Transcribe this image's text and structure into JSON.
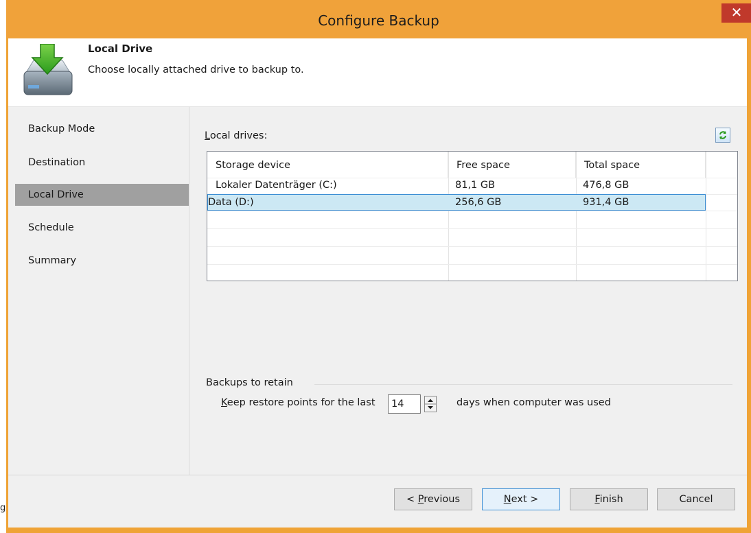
{
  "window": {
    "title": "Configure Backup",
    "close_glyph": "✕"
  },
  "header": {
    "title": "Local Drive",
    "description": "Choose locally attached drive to backup to.",
    "icon": "drive-download-icon"
  },
  "sidebar": {
    "items": [
      {
        "label": "Backup Mode",
        "active": false
      },
      {
        "label": "Destination",
        "active": false
      },
      {
        "label": "Local Drive",
        "active": true
      },
      {
        "label": "Schedule",
        "active": false
      },
      {
        "label": "Summary",
        "active": false
      }
    ]
  },
  "drives": {
    "label_prefix": "",
    "label_underlined": "L",
    "label_rest": "ocal drives:",
    "columns": [
      "Storage device",
      "Free space",
      "Total space"
    ],
    "rows": [
      {
        "device": "Lokaler Datenträger (C:)",
        "free": "81,1 GB",
        "total": "476,8 GB",
        "selected": false
      },
      {
        "device": "Data (D:)",
        "free": "256,6 GB",
        "total": "931,4 GB",
        "selected": true
      }
    ]
  },
  "retention": {
    "group_label": "Backups to retain",
    "keep_prefix": "K",
    "keep_rest": "eep restore points for the last",
    "days_value": "14",
    "days_label": "days when computer was used"
  },
  "buttons": {
    "previous_pre": "< ",
    "previous_u": "P",
    "previous_rest": "revious",
    "next_u": "N",
    "next_rest": "ext >",
    "finish_u": "F",
    "finish_rest": "inish",
    "cancel": "Cancel"
  },
  "edge_text": "gl",
  "colors": {
    "frame": "#f0a23a",
    "close": "#c0392b",
    "selection": "#cce8f4",
    "nav_active": "#a0a0a0"
  }
}
